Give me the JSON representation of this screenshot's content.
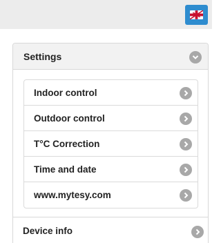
{
  "header": {
    "language_icon": "uk-flag-icon",
    "accent_color": "#2e8ccf"
  },
  "settings": {
    "title": "Settings",
    "toggle_icon": "chevron-down-icon",
    "items": [
      {
        "label": "Indoor control",
        "icon": "chevron-right-icon"
      },
      {
        "label": "Outdoor control",
        "icon": "chevron-right-icon"
      },
      {
        "label": "T°C Correction",
        "icon": "chevron-right-icon"
      },
      {
        "label": "Time and date",
        "icon": "chevron-right-icon"
      },
      {
        "label": "www.mytesy.com",
        "icon": "chevron-right-icon"
      }
    ]
  },
  "device_info": {
    "label": "Device info",
    "icon": "chevron-right-icon"
  }
}
